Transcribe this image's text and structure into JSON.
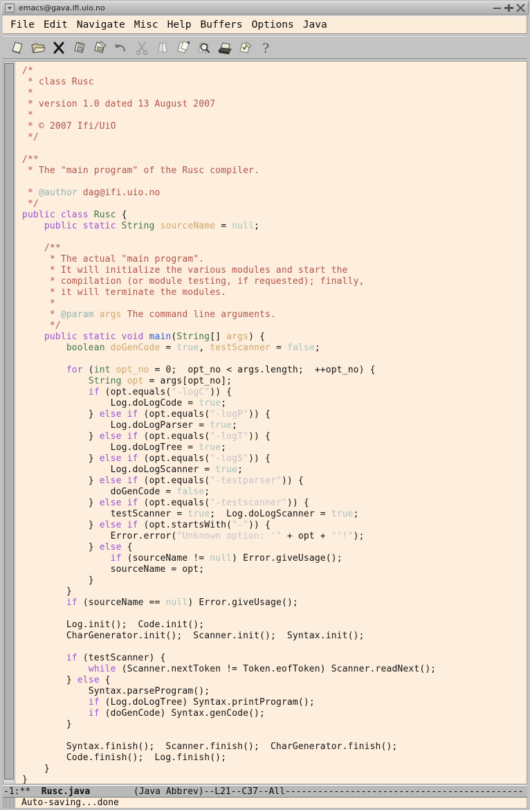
{
  "window": {
    "title": "emacs@gava.ifi.uio.no",
    "buttons": [
      {
        "name": "minimize",
        "glyph": "minimize-icon"
      },
      {
        "name": "maximize",
        "glyph": "maximize-icon"
      },
      {
        "name": "close",
        "glyph": "close-icon"
      }
    ]
  },
  "menubar": {
    "items": [
      {
        "label": "File"
      },
      {
        "label": "Edit"
      },
      {
        "label": "Navigate"
      },
      {
        "label": "Misc"
      },
      {
        "label": "Help"
      },
      {
        "label": "Buffers"
      },
      {
        "label": "Options"
      },
      {
        "label": "Java"
      }
    ]
  },
  "toolbar": {
    "items": [
      {
        "name": "new-file-icon",
        "tooltip": "New File"
      },
      {
        "name": "open-folder-icon",
        "tooltip": "Open"
      },
      {
        "name": "close-buffer-icon",
        "tooltip": "Close"
      },
      {
        "name": "save-icon",
        "tooltip": "Save"
      },
      {
        "name": "save-as-icon",
        "tooltip": "Save As"
      },
      {
        "name": "undo-icon",
        "tooltip": "Undo"
      },
      {
        "name": "cut-scissors-icon",
        "tooltip": "Cut"
      },
      {
        "name": "copy-icon",
        "tooltip": "Copy"
      },
      {
        "name": "paste-icon",
        "tooltip": "Paste"
      },
      {
        "name": "search-icon",
        "tooltip": "Search"
      },
      {
        "name": "print-icon",
        "tooltip": "Print"
      },
      {
        "name": "spellcheck-icon",
        "tooltip": "Spell Check"
      },
      {
        "name": "help-icon",
        "tooltip": "Help"
      }
    ]
  },
  "modeline": {
    "prefix": "-1:**",
    "buffer_name": "Rusc.java",
    "major_mode": "(Java Abbrev)",
    "position": "--L21--C37--All",
    "filler": "--------------------------------------------"
  },
  "minibuffer": {
    "message": "Auto-saving...done"
  },
  "editor": {
    "lines": [
      [
        {
          "t": "/*",
          "c": "comment"
        }
      ],
      [
        {
          "t": " * class Rusc",
          "c": "comment"
        }
      ],
      [
        {
          "t": " *",
          "c": "comment"
        }
      ],
      [
        {
          "t": " * version 1.0 dated 13 August 2007",
          "c": "comment"
        }
      ],
      [
        {
          "t": " *",
          "c": "comment"
        }
      ],
      [
        {
          "t": " * © 2007 Ifi/UiO",
          "c": "comment"
        }
      ],
      [
        {
          "t": " */",
          "c": "comment"
        }
      ],
      [],
      [
        {
          "t": "/**",
          "c": "comment"
        }
      ],
      [
        {
          "t": " * The \"main program\" of the Rusc compiler.",
          "c": "comment"
        }
      ],
      [],
      [
        {
          "t": " * ",
          "c": "comment"
        },
        {
          "t": "@author",
          "c": "doctag"
        },
        {
          "t": " dag@ifi.uio.no",
          "c": "comment"
        }
      ],
      [
        {
          "t": " */",
          "c": "comment"
        }
      ],
      [
        {
          "t": "public class ",
          "c": "kw"
        },
        {
          "t": "Rusc",
          "c": "type"
        },
        {
          "t": " {",
          "c": "plain"
        }
      ],
      [
        {
          "t": "    ",
          "c": "plain"
        },
        {
          "t": "public static ",
          "c": "kw"
        },
        {
          "t": "String",
          "c": "type"
        },
        {
          "t": " ",
          "c": "plain"
        },
        {
          "t": "sourceName",
          "c": "var"
        },
        {
          "t": " = ",
          "c": "plain"
        },
        {
          "t": "null",
          "c": "const"
        },
        {
          "t": ";",
          "c": "plain"
        }
      ],
      [],
      [
        {
          "t": "    /**",
          "c": "comment"
        }
      ],
      [
        {
          "t": "     * The actual \"main program\".",
          "c": "comment"
        }
      ],
      [
        {
          "t": "     * It will initialize the various modules and start the",
          "c": "comment"
        }
      ],
      [
        {
          "t": "     * compilation (or module testing, if requested); finally,",
          "c": "comment"
        }
      ],
      [
        {
          "t": "     * it will terminate the modules.",
          "c": "comment"
        }
      ],
      [
        {
          "t": "     *",
          "c": "comment"
        }
      ],
      [
        {
          "t": "     * ",
          "c": "comment"
        },
        {
          "t": "@param",
          "c": "doctag"
        },
        {
          "t": " ",
          "c": "comment"
        },
        {
          "t": "args",
          "c": "var"
        },
        {
          "t": " The command line arguments.",
          "c": "comment"
        }
      ],
      [
        {
          "t": "     */",
          "c": "comment"
        }
      ],
      [
        {
          "t": "    ",
          "c": "plain"
        },
        {
          "t": "public static void ",
          "c": "kw"
        },
        {
          "t": "main",
          "c": "func"
        },
        {
          "t": "(",
          "c": "plain"
        },
        {
          "t": "String",
          "c": "type"
        },
        {
          "t": "[] ",
          "c": "plain"
        },
        {
          "t": "args",
          "c": "var"
        },
        {
          "t": ") {",
          "c": "plain"
        }
      ],
      [
        {
          "t": "        ",
          "c": "plain"
        },
        {
          "t": "boolean",
          "c": "type"
        },
        {
          "t": " ",
          "c": "plain"
        },
        {
          "t": "doGenCode",
          "c": "var"
        },
        {
          "t": " = ",
          "c": "plain"
        },
        {
          "t": "true",
          "c": "const"
        },
        {
          "t": ", ",
          "c": "plain"
        },
        {
          "t": "testScanner",
          "c": "var"
        },
        {
          "t": " = ",
          "c": "plain"
        },
        {
          "t": "false",
          "c": "const"
        },
        {
          "t": ";",
          "c": "plain"
        }
      ],
      [],
      [
        {
          "t": "        ",
          "c": "plain"
        },
        {
          "t": "for",
          "c": "kw"
        },
        {
          "t": " (",
          "c": "plain"
        },
        {
          "t": "int",
          "c": "type"
        },
        {
          "t": " ",
          "c": "plain"
        },
        {
          "t": "opt_no",
          "c": "var"
        },
        {
          "t": " = 0;  opt_no < args.length;  ++opt_no) {",
          "c": "plain"
        }
      ],
      [
        {
          "t": "            ",
          "c": "plain"
        },
        {
          "t": "String",
          "c": "type"
        },
        {
          "t": " ",
          "c": "plain"
        },
        {
          "t": "opt",
          "c": "var"
        },
        {
          "t": " = args[opt_no];",
          "c": "plain"
        }
      ],
      [
        {
          "t": "            ",
          "c": "plain"
        },
        {
          "t": "if",
          "c": "kw"
        },
        {
          "t": " (opt.equals(",
          "c": "plain"
        },
        {
          "t": "\"-logC\"",
          "c": "str"
        },
        {
          "t": ")) {",
          "c": "plain"
        }
      ],
      [
        {
          "t": "                Log.doLogCode = ",
          "c": "plain"
        },
        {
          "t": "true",
          "c": "const"
        },
        {
          "t": ";",
          "c": "plain"
        }
      ],
      [
        {
          "t": "            } ",
          "c": "plain"
        },
        {
          "t": "else if",
          "c": "kw"
        },
        {
          "t": " (opt.equals(",
          "c": "plain"
        },
        {
          "t": "\"-logP\"",
          "c": "str"
        },
        {
          "t": ")) {",
          "c": "plain"
        }
      ],
      [
        {
          "t": "                Log.doLogParser = ",
          "c": "plain"
        },
        {
          "t": "true",
          "c": "const"
        },
        {
          "t": ";",
          "c": "plain"
        }
      ],
      [
        {
          "t": "            } ",
          "c": "plain"
        },
        {
          "t": "else if",
          "c": "kw"
        },
        {
          "t": " (opt.equals(",
          "c": "plain"
        },
        {
          "t": "\"-logT\"",
          "c": "str"
        },
        {
          "t": ")) {",
          "c": "plain"
        }
      ],
      [
        {
          "t": "                Log.doLogTree = ",
          "c": "plain"
        },
        {
          "t": "true",
          "c": "const"
        },
        {
          "t": ";",
          "c": "plain"
        }
      ],
      [
        {
          "t": "            } ",
          "c": "plain"
        },
        {
          "t": "else if",
          "c": "kw"
        },
        {
          "t": " (opt.equals(",
          "c": "plain"
        },
        {
          "t": "\"-logS\"",
          "c": "str"
        },
        {
          "t": ")) {",
          "c": "plain"
        }
      ],
      [
        {
          "t": "                Log.doLogScanner = ",
          "c": "plain"
        },
        {
          "t": "true",
          "c": "const"
        },
        {
          "t": ";",
          "c": "plain"
        }
      ],
      [
        {
          "t": "            } ",
          "c": "plain"
        },
        {
          "t": "else if",
          "c": "kw"
        },
        {
          "t": " (opt.equals(",
          "c": "plain"
        },
        {
          "t": "\"-testparser\"",
          "c": "str"
        },
        {
          "t": ")) {",
          "c": "plain"
        }
      ],
      [
        {
          "t": "                doGenCode = ",
          "c": "plain"
        },
        {
          "t": "false",
          "c": "const"
        },
        {
          "t": ";",
          "c": "plain"
        }
      ],
      [
        {
          "t": "            } ",
          "c": "plain"
        },
        {
          "t": "else if",
          "c": "kw"
        },
        {
          "t": " (opt.equals(",
          "c": "plain"
        },
        {
          "t": "\"-testscanner\"",
          "c": "str"
        },
        {
          "t": ")) {",
          "c": "plain"
        }
      ],
      [
        {
          "t": "                testScanner = ",
          "c": "plain"
        },
        {
          "t": "true",
          "c": "const"
        },
        {
          "t": ";  Log.doLogScanner = ",
          "c": "plain"
        },
        {
          "t": "true",
          "c": "const"
        },
        {
          "t": ";",
          "c": "plain"
        }
      ],
      [
        {
          "t": "            } ",
          "c": "plain"
        },
        {
          "t": "else if",
          "c": "kw"
        },
        {
          "t": " (opt.startsWith(",
          "c": "plain"
        },
        {
          "t": "\"-\"",
          "c": "str"
        },
        {
          "t": ")) {",
          "c": "plain"
        }
      ],
      [
        {
          "t": "                Error.error(",
          "c": "plain"
        },
        {
          "t": "\"Unknown option: '\"",
          "c": "str"
        },
        {
          "t": " + opt + ",
          "c": "plain"
        },
        {
          "t": "\"'!\"",
          "c": "str"
        },
        {
          "t": ");",
          "c": "plain"
        }
      ],
      [
        {
          "t": "            } ",
          "c": "plain"
        },
        {
          "t": "else",
          "c": "kw"
        },
        {
          "t": " {",
          "c": "plain"
        }
      ],
      [
        {
          "t": "                ",
          "c": "plain"
        },
        {
          "t": "if",
          "c": "kw"
        },
        {
          "t": " (sourceName != ",
          "c": "plain"
        },
        {
          "t": "null",
          "c": "const"
        },
        {
          "t": ") Error.giveUsage();",
          "c": "plain"
        }
      ],
      [
        {
          "t": "                sourceName = opt;",
          "c": "plain"
        }
      ],
      [
        {
          "t": "            }",
          "c": "plain"
        }
      ],
      [
        {
          "t": "        }",
          "c": "plain"
        }
      ],
      [
        {
          "t": "        ",
          "c": "plain"
        },
        {
          "t": "if",
          "c": "kw"
        },
        {
          "t": " (sourceName == ",
          "c": "plain"
        },
        {
          "t": "null",
          "c": "const"
        },
        {
          "t": ") Error.giveUsage();",
          "c": "plain"
        }
      ],
      [],
      [
        {
          "t": "        Log.init();  Code.init();",
          "c": "plain"
        }
      ],
      [
        {
          "t": "        CharGenerator.init();  Scanner.init();  Syntax.init();",
          "c": "plain"
        }
      ],
      [],
      [
        {
          "t": "        ",
          "c": "plain"
        },
        {
          "t": "if",
          "c": "kw"
        },
        {
          "t": " (testScanner) {",
          "c": "plain"
        }
      ],
      [
        {
          "t": "            ",
          "c": "plain"
        },
        {
          "t": "while",
          "c": "kw"
        },
        {
          "t": " (Scanner.nextToken != Token.eofToken) Scanner.readNext();",
          "c": "plain"
        }
      ],
      [
        {
          "t": "        } ",
          "c": "plain"
        },
        {
          "t": "else",
          "c": "kw"
        },
        {
          "t": " {",
          "c": "plain"
        }
      ],
      [
        {
          "t": "            Syntax.parseProgram();",
          "c": "plain"
        }
      ],
      [
        {
          "t": "            ",
          "c": "plain"
        },
        {
          "t": "if",
          "c": "kw"
        },
        {
          "t": " (Log.doLogTree) Syntax.printProgram();",
          "c": "plain"
        }
      ],
      [
        {
          "t": "            ",
          "c": "plain"
        },
        {
          "t": "if",
          "c": "kw"
        },
        {
          "t": " (doGenCode) Syntax.genCode();",
          "c": "plain"
        }
      ],
      [
        {
          "t": "        }",
          "c": "plain"
        }
      ],
      [],
      [
        {
          "t": "        Syntax.finish();  Scanner.finish();  CharGenerator.finish();",
          "c": "plain"
        }
      ],
      [
        {
          "t": "        Code.finish();  Log.finish();",
          "c": "plain"
        }
      ],
      [
        {
          "t": "    }",
          "c": "plain"
        }
      ],
      [
        {
          "t": "}",
          "c": "plain"
        }
      ]
    ]
  },
  "colors": {
    "background": "#fdeedd",
    "comment": "#b0544a",
    "keyword": "#9a52d8",
    "type": "#3f7a3f",
    "variable": "#cfa76a",
    "function": "#2b62d9",
    "string": "#c8c0c8",
    "constant": "#a8c4c0",
    "modeline_bg": "#b9b9b9",
    "menubar_bg": "#faecd9",
    "toolbar_bg": "#c3c3c3"
  }
}
